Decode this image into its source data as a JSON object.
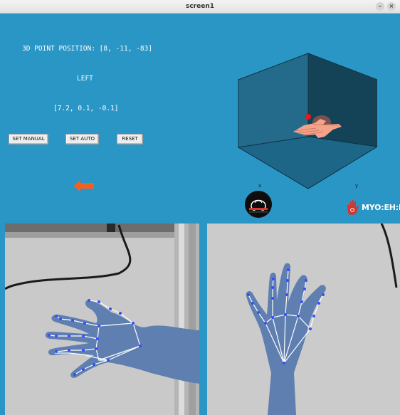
{
  "window": {
    "title": "screen1",
    "minimize_icon": "minimize-icon",
    "close_icon": "close-icon"
  },
  "controls": {
    "position_text": "3D POINT POSITION: [8, -11, -83]",
    "hand_side": "LEFT",
    "vector_text": "[7.2, 0.1, -0.1]",
    "buttons": [
      "SET MANUAL",
      "SET AUTO",
      "RESET"
    ],
    "direction_icon": "arrow-left-icon"
  },
  "view3d": {
    "x_axis_label": "x",
    "y_axis_label": "y",
    "box_color": "#1f5f7a",
    "point_color": "#e8181a",
    "hand_color": "#f4a38a"
  },
  "logos": {
    "logo1_icon": "human-robotics-logo",
    "logo2_text": "MYO:EH:B",
    "logo2_icon": "hand-logo-icon"
  },
  "colors": {
    "background": "#2a96c5",
    "landmark": "#3a4bff",
    "connection": "#ffffff"
  },
  "cameras": [
    {
      "name": "left-camera-feed",
      "content": "hand with tracked landmarks, side view"
    },
    {
      "name": "right-camera-feed",
      "content": "hand with tracked landmarks, palm view"
    }
  ]
}
